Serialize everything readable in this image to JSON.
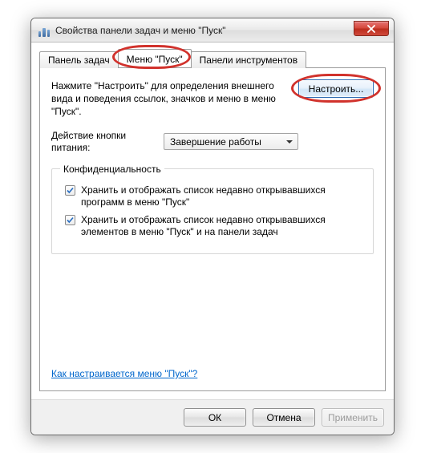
{
  "window": {
    "title": "Свойства панели задач и меню \"Пуск\""
  },
  "tabs": [
    {
      "label": "Панель задач"
    },
    {
      "label": "Меню \"Пуск\""
    },
    {
      "label": "Панели инструментов"
    }
  ],
  "page": {
    "instruction": "Нажмите \"Настроить\" для определения внешнего вида и поведения ссылок, значков и меню в меню \"Пуск\".",
    "configure_label": "Настроить...",
    "power_label": "Действие кнопки питания:",
    "power_value": "Завершение работы",
    "privacy_legend": "Конфиденциальность",
    "cb1": "Хранить и отображать список недавно открывавшихся программ в меню \"Пуск\"",
    "cb2": "Хранить и отображать список недавно открывавшихся элементов в меню \"Пуск\" и на панели задач",
    "help_link": "Как настраивается меню \"Пуск\"?"
  },
  "footer": {
    "ok": "ОК",
    "cancel": "Отмена",
    "apply": "Применить"
  }
}
